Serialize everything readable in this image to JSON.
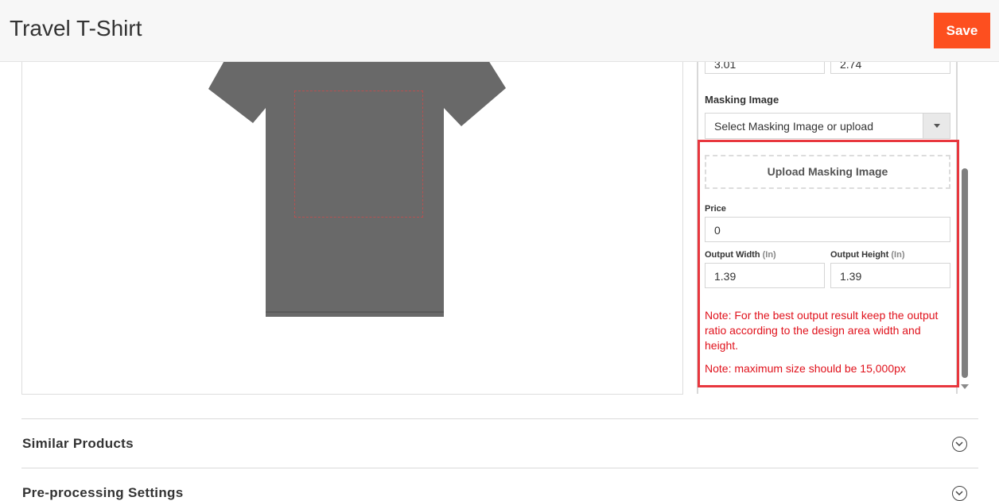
{
  "header": {
    "title": "Travel T-Shirt",
    "save_label": "Save"
  },
  "preview": {
    "shirt_color": "#696969",
    "design_area_border_color": "#b65151"
  },
  "settings": {
    "width_value": "3.01",
    "height_value": "2.74",
    "masking_image_label": "Masking Image",
    "masking_select_value": "Select Masking Image or upload",
    "upload_button_label": "Upload Masking Image",
    "price_label": "Price",
    "price_value": "0",
    "output_width_label": "Output Width",
    "output_height_label": "Output Height",
    "unit_label": "(In)",
    "output_width_value": "1.39",
    "output_height_value": "1.39",
    "note_ratio": "Note: For the best output result keep the output ratio according to the design area width and height.",
    "note_max_size": "Note: maximum size should be 15,000px"
  },
  "accordions": {
    "similar_products": "Similar Products",
    "preprocessing_settings": "Pre-processing Settings"
  },
  "colors": {
    "accent": "#fd4f1f",
    "note_text": "#e0111b",
    "highlight": "#e8373e"
  }
}
